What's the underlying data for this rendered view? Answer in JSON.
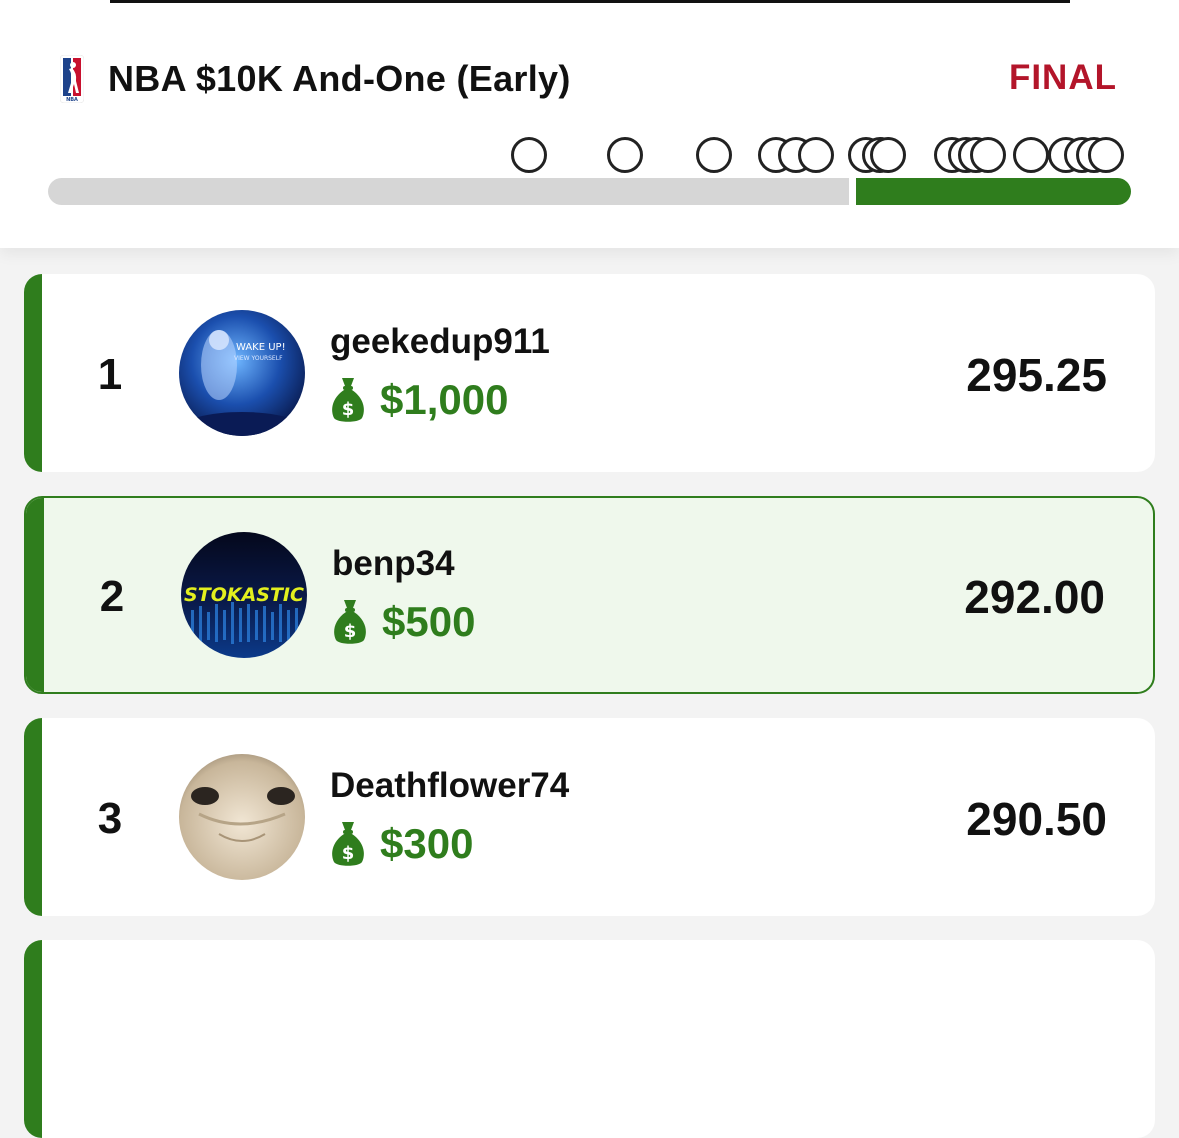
{
  "contest": {
    "title": "NBA $10K And-One (Early)",
    "status": "FINAL",
    "logo_icon": "nba-logo-icon"
  },
  "progress": {
    "completed_fraction": 0.74,
    "marker_count": 19
  },
  "leaderboard": [
    {
      "rank": "1",
      "username": "geekedup911",
      "prize": "$1,000",
      "score": "295.25",
      "highlighted": false,
      "avatar_text": [
        "WAKE UP!",
        "VIEW YOURSELF"
      ]
    },
    {
      "rank": "2",
      "username": "benp34",
      "prize": "$500",
      "score": "292.00",
      "highlighted": true,
      "avatar_text": [
        "STOKASTIC"
      ]
    },
    {
      "rank": "3",
      "username": "Deathflower74",
      "prize": "$300",
      "score": "290.50",
      "highlighted": false,
      "avatar_text": []
    }
  ],
  "colors": {
    "accent_green": "#2f7d1d",
    "status_red": "#b3152a",
    "highlight_bg": "#eff8ec"
  }
}
